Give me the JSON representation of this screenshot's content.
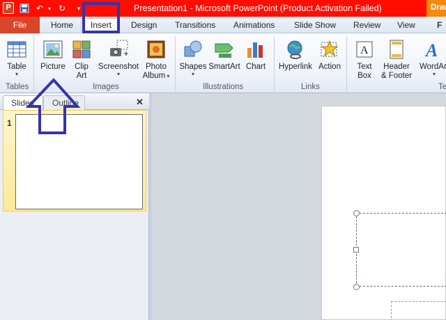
{
  "window": {
    "title": "Presentation1 - Microsoft PowerPoint (Product Activation Failed)",
    "app_icon_letter": "P",
    "contextual_tab_group": "Drawing Tools",
    "contextual_tab": "F"
  },
  "colors": {
    "titlebar": "#ff0d00",
    "file_tab": "#d9452b",
    "annotation": "#3634a8",
    "drawing_tools": "#f28a0c"
  },
  "quick_access": [
    "save-icon",
    "undo-icon",
    "redo-icon",
    "customize-icon"
  ],
  "tabs": {
    "file": "File",
    "items": [
      "Home",
      "Insert",
      "Design",
      "Transitions",
      "Animations",
      "Slide Show",
      "Review",
      "View"
    ],
    "active": "Insert"
  },
  "ribbon": {
    "groups": {
      "tables": "Tables",
      "images": "Images",
      "illustrations": "Illustrations",
      "links": "Links",
      "text": "Te"
    },
    "buttons": {
      "table": {
        "l1": "Table",
        "icon": "table-icon"
      },
      "picture": {
        "l1": "Picture",
        "icon": "picture-icon"
      },
      "clip_art": {
        "l1": "Clip",
        "l2": "Art",
        "icon": "clip-art-icon"
      },
      "screenshot": {
        "l1": "Screenshot",
        "icon": "screenshot-icon"
      },
      "photo_album": {
        "l1": "Photo",
        "l2": "Album",
        "icon": "photo-album-icon"
      },
      "shapes": {
        "l1": "Shapes",
        "icon": "shapes-icon"
      },
      "smartart": {
        "l1": "SmartArt",
        "icon": "smartart-icon"
      },
      "chart": {
        "l1": "Chart",
        "icon": "chart-icon"
      },
      "hyperlink": {
        "l1": "Hyperlink",
        "icon": "hyperlink-icon"
      },
      "action": {
        "l1": "Action",
        "icon": "action-icon"
      },
      "text_box": {
        "l1": "Text",
        "l2": "Box",
        "icon": "text-box-icon"
      },
      "header_footer": {
        "l1": "Header",
        "l2": "& Footer",
        "icon": "header-footer-icon"
      },
      "wordart": {
        "l1": "WordArt",
        "icon": "wordart-icon"
      }
    }
  },
  "slides_pane": {
    "tab_slides": "Slides",
    "tab_outline": "Outline",
    "close": "✕",
    "slides": [
      {
        "number": "1"
      }
    ]
  }
}
